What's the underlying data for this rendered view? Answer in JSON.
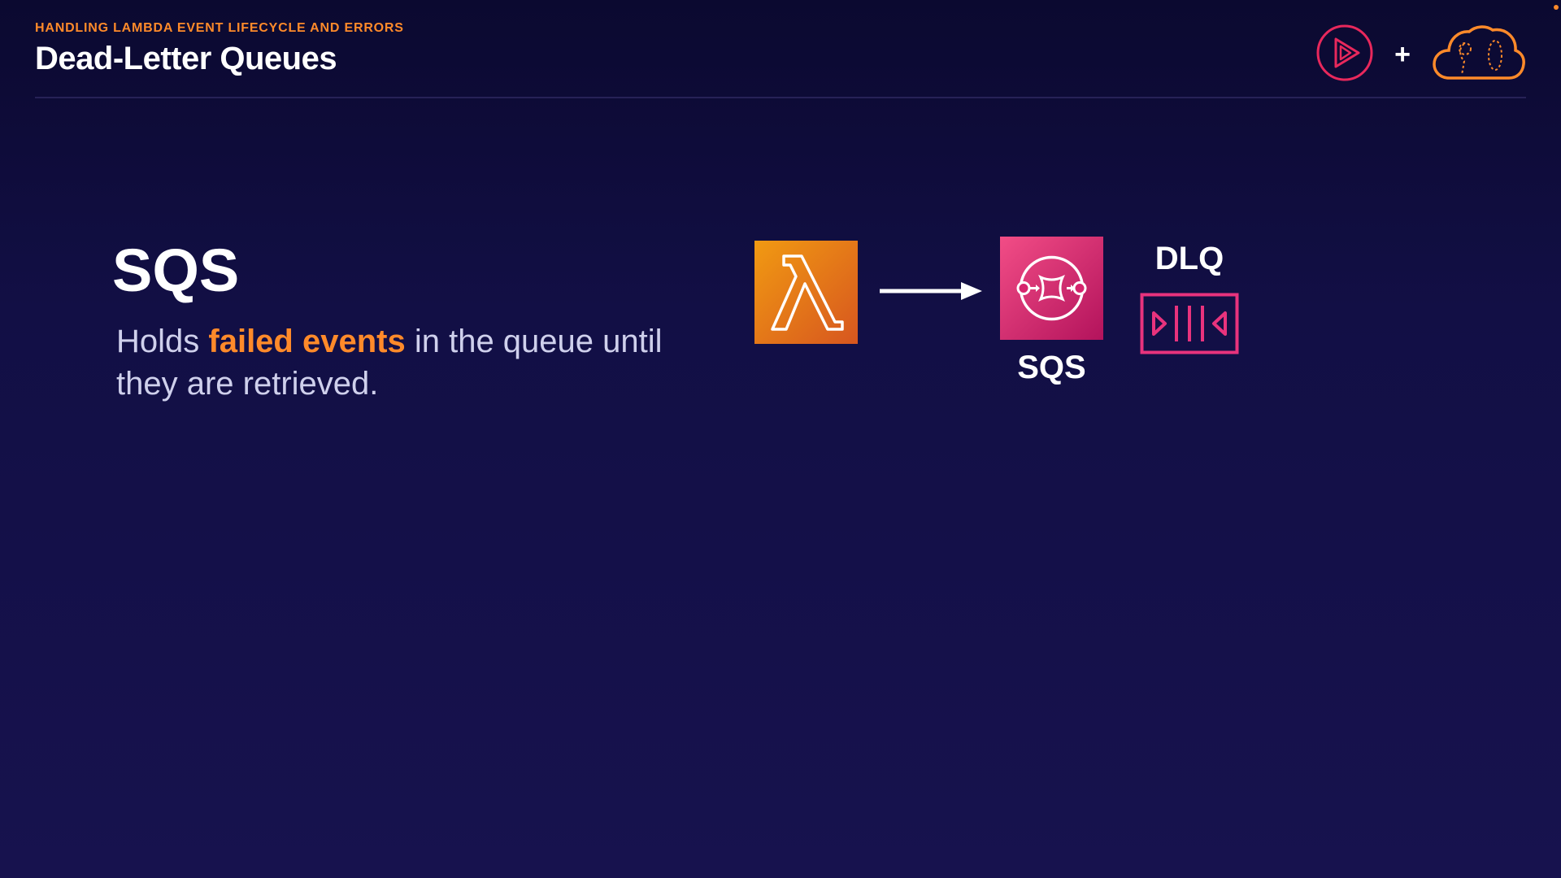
{
  "header": {
    "kicker": "HANDLING LAMBDA EVENT LIFECYCLE AND ERRORS",
    "title": "Dead-Letter Queues",
    "plus": "+",
    "logos": [
      "play-logo-icon",
      "cloud-logo-icon"
    ]
  },
  "content": {
    "section_title": "SQS",
    "desc_before": "Holds ",
    "desc_highlight": "failed events",
    "desc_after": " in the queue until they are retrieved."
  },
  "diagram": {
    "nodes": [
      {
        "id": "lambda",
        "icon": "lambda-icon",
        "color": "#e8721a"
      },
      {
        "id": "sqs",
        "icon": "sqs-icon",
        "label": "SQS",
        "color": "#d6246d"
      },
      {
        "id": "dlq",
        "icon": "queue-icon",
        "label": "DLQ",
        "color": "#e8337d"
      }
    ]
  },
  "colors": {
    "accent": "#ff8a2a",
    "background": "#120f45",
    "text_muted": "#cfd0ec"
  }
}
